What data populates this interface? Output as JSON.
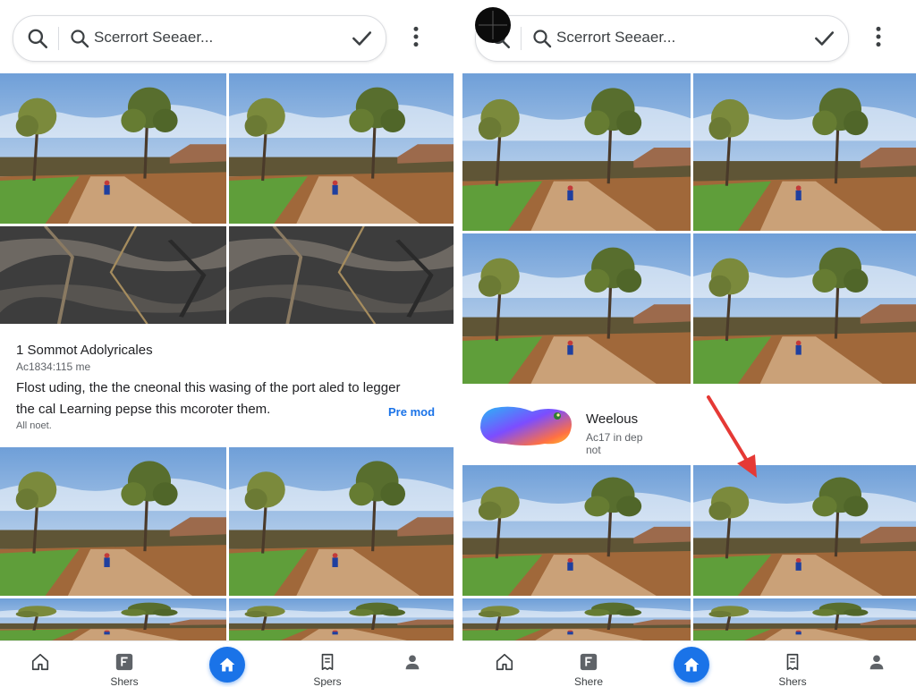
{
  "colors": {
    "accent": "#1a73e8",
    "arrow": "#e53935",
    "text": "#202124",
    "muted": "#5f6368"
  },
  "left_pane": {
    "search": {
      "value": "Scerrort Seeaer...",
      "lead_icon": "search-icon",
      "trail_icon": "checkmark-icon"
    },
    "menu_icon": "more-vert-icon",
    "info_card": {
      "title": "1 Sommot Adolyricales",
      "subtitle": "Ac1834:115 me",
      "body_line1": "Flost uding, the the cneonal this wasing of the port aled to legger",
      "body_line2": "the cal Learning pepse this mcoroter them.",
      "footer": "All noet.",
      "link": "Pre mod"
    },
    "nav": [
      {
        "icon": "home-outline-icon",
        "label": ""
      },
      {
        "icon": "f-square-icon",
        "label": "Shers"
      },
      {
        "icon": "home-icon",
        "label": "",
        "active": true
      },
      {
        "icon": "receipt-icon",
        "label": "Spers"
      },
      {
        "icon": "person-icon",
        "label": ""
      }
    ]
  },
  "right_pane": {
    "search": {
      "value": "Scerrort Seeaer...",
      "lead_icon": "search-icon",
      "trail_icon": "checkmark-icon"
    },
    "menu_icon": "more-vert-icon",
    "promo_card": {
      "title": "Weelous",
      "line1": "Ac17 in dep",
      "line2": "not"
    },
    "nav": [
      {
        "icon": "home-outline-icon",
        "label": ""
      },
      {
        "icon": "f-square-icon",
        "label": "Shere"
      },
      {
        "icon": "home-icon",
        "label": "",
        "active": true
      },
      {
        "icon": "receipt-icon",
        "label": "Shers"
      },
      {
        "icon": "person-icon",
        "label": ""
      }
    ]
  }
}
